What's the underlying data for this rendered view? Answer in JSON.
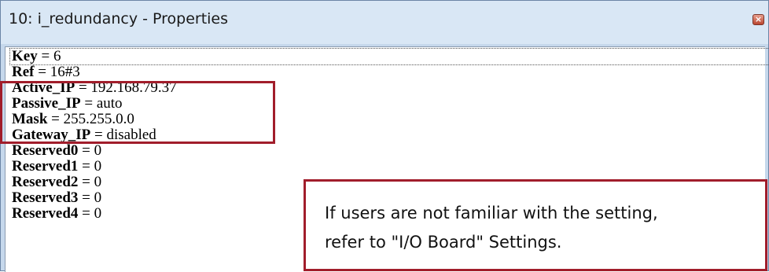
{
  "window": {
    "title": "10: i_redundancy - Properties",
    "close_icon": "close-icon",
    "close_glyph": "×"
  },
  "properties": [
    {
      "key": "Key",
      "sep": " = ",
      "value": "6"
    },
    {
      "key": "Ref",
      "sep": " = ",
      "value": "16#3"
    },
    {
      "key": "Active_IP",
      "sep": " = ",
      "value": "192.168.79.37"
    },
    {
      "key": "Passive_IP",
      "sep": " = ",
      "value": "auto"
    },
    {
      "key": "Mask",
      "sep": " = ",
      "value": "255.255.0.0"
    },
    {
      "key": "Gateway_IP",
      "sep": " = ",
      "value": "disabled"
    },
    {
      "key": "Reserved0",
      "sep": " = ",
      "value": "0"
    },
    {
      "key": "Reserved1",
      "sep": " = ",
      "value": "0"
    },
    {
      "key": "Reserved2",
      "sep": " = ",
      "value": "0"
    },
    {
      "key": "Reserved3",
      "sep": " = ",
      "value": "0"
    },
    {
      "key": "Reserved4",
      "sep": " = ",
      "value": "0"
    }
  ],
  "note": {
    "line1": "If users are not familiar with the setting,",
    "line2": "refer to \"I/O Board\" Settings."
  },
  "colors": {
    "annotation_border": "#a11d2b",
    "titlebar": "#d9e7f5",
    "close_button": "#c45a45"
  }
}
